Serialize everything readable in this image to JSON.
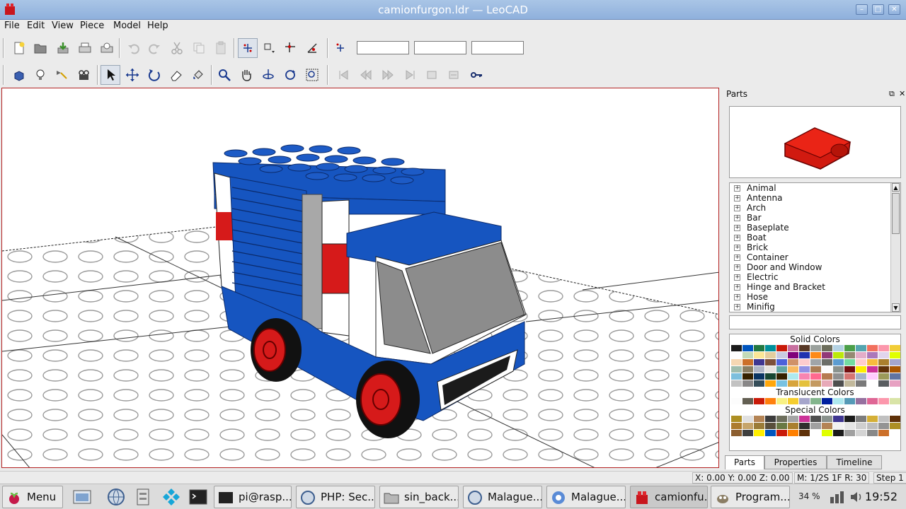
{
  "window": {
    "title": "camionfurgon.ldr — LeoCAD",
    "icon": "leocad-brick-icon",
    "buttons": [
      "minimize-icon",
      "maximize-icon",
      "close-icon"
    ]
  },
  "menu": [
    "File",
    "Edit",
    "View",
    "Piece",
    "Model",
    "Help"
  ],
  "toolbar1": {
    "icons": [
      "new-file-icon",
      "open-folder-icon",
      "save-icon",
      "print-icon",
      "print-preview-icon",
      "undo-icon",
      "redo-icon",
      "cut-icon",
      "copy-icon",
      "paste-icon",
      "snap-move-icon",
      "snap-xy-icon",
      "snap-grid-icon",
      "snap-angle-icon",
      "transform-icon"
    ],
    "coordinate_fields": [
      "",
      "",
      ""
    ]
  },
  "toolbar2": {
    "icons": [
      "insert-brick-icon",
      "light-icon",
      "spotlight-icon",
      "camera-icon",
      "select-arrow-icon",
      "move-icon",
      "rotate-icon",
      "eraser-icon",
      "paint-icon",
      "zoom-icon",
      "pan-hand-icon",
      "rotate-view-icon",
      "roll-icon",
      "zoom-region-icon",
      "first-step-icon",
      "previous-step-icon",
      "next-step-icon",
      "last-step-icon",
      "insert-step-icon",
      "remove-step-icon",
      "key-icon"
    ]
  },
  "parts_panel": {
    "title": "Parts",
    "categories": [
      "Animal",
      "Antenna",
      "Arch",
      "Bar",
      "Baseplate",
      "Boat",
      "Brick",
      "Container",
      "Door and Window",
      "Electric",
      "Hinge and Bracket",
      "Hose",
      "Minifig"
    ],
    "search_value": "",
    "color_groups": [
      {
        "name": "Solid Colors",
        "colors": [
          "#1b1b1b",
          "#0055bf",
          "#237841",
          "#008f9b",
          "#c91a09",
          "#c870a0",
          "#583927",
          "#9ba19d",
          "#6d6e5c",
          "#b4d2e3",
          "#4b9f4a",
          "#55a5af",
          "#f2705e",
          "#fc97ac",
          "#f2cd37",
          "#fefefe",
          "#c2dab8",
          "#fbe696",
          "#e4cd9e",
          "#c9cae2",
          "#81007b",
          "#2032b0",
          "#fe8a18",
          "#923978",
          "#bbe90b",
          "#958a73",
          "#e4adc8",
          "#ac78ba",
          "#e1d5ed",
          "#e0ff00",
          "#f6d7b3",
          "#cc702a",
          "#3f3691",
          "#7c503a",
          "#4c61db",
          "#d09168",
          "#feccce",
          "#a0a5a9",
          "#6c6e68",
          "#5c9dd1",
          "#73dca1",
          "#fecccf",
          "#f8bb3d",
          "#aa7f2e",
          "#a5a5cb",
          "#a0bcac",
          "#897d62",
          "#afb5c7",
          "#e6e3e0",
          "#62a6a4",
          "#f9ba61",
          "#9391e4",
          "#aa7d55",
          "#fcfcfc",
          "#8a928d",
          "#720e0f",
          "#ffee00",
          "#cc3399",
          "#5f3109",
          "#a95500",
          "#7dbfdd",
          "#352100",
          "#0a3463",
          "#184632",
          "#352100",
          "#aee9ef",
          "#f785b1",
          "#ff698f",
          "#b67b50",
          "#909090",
          "#d67572",
          "#a5b2c7",
          "#ffccff",
          "#9b9a5a",
          "#6074a1",
          "#c2c2c2",
          "#898788",
          "#354e5a",
          "#ffa70b",
          "#79c2e1",
          "#d7a43c",
          "#e4c13c",
          "#c49a62",
          "#e7a9b8",
          "#4e4e4e",
          "#c2b99c",
          "#7a7a7a",
          "#ffffff",
          "#595d60",
          "#e7a1c2"
        ]
      },
      {
        "name": "Translucent Colors",
        "colors": [
          "#fcfcfc",
          "#635f52",
          "#c91a09",
          "#ff800d",
          "#f8f184",
          "#f5cd2f",
          "#a5a5cb",
          "#84b68d",
          "#0020a0",
          "#aee9ef",
          "#559ab7",
          "#96709f",
          "#df6695",
          "#fc97ac",
          "#d9e4a7"
        ]
      },
      {
        "name": "Special Colors",
        "colors": [
          "#ad8f23",
          "#e0e0e0",
          "#b48455",
          "#3c3c3c",
          "#6d6e5c",
          "#a5a5a5",
          "#cc3399",
          "#4f4f4f",
          "#8a928d",
          "#3f3691",
          "#1b1b1b",
          "#7d7d7d",
          "#d4af37",
          "#c0c0c0",
          "#5f3109",
          "#ad7c2e",
          "#c6a56b",
          "#9b7c38",
          "#594f3c",
          "#6a7944",
          "#aa7f2e",
          "#2e2e2e",
          "#a0a0a0",
          "#b48455",
          "#f2f2f2",
          "#e6e6e6",
          "#cfcfcf",
          "#bdbdbd",
          "#949494",
          "#ad8f23",
          "#8c5e2f",
          "#3f3f3f",
          "#ffee00",
          "#0055bf",
          "#c91a09",
          "#ff7f00",
          "#5f3109",
          "#ffffff",
          "#e0ff00",
          "#1b1b1b",
          "#a0a0a0",
          "#d4d4d4",
          "#888888",
          "#cc702a",
          "#ffffff"
        ]
      }
    ],
    "tabs": [
      "Parts",
      "Properties",
      "Timeline"
    ]
  },
  "statusbar": {
    "coords": "X: 0.00 Y: 0.00 Z: 0.00",
    "grid": "M: 1/2S 1F R: 30",
    "step": "Step 1"
  },
  "taskbar": {
    "menu_label": "Menu",
    "launchers": [
      "file-manager-icon",
      "browser-globe-icon",
      "archive-icon",
      "kodi-icon",
      "terminal-icon"
    ],
    "items": [
      {
        "label": "pi@rasp...",
        "icon": "terminal-icon"
      },
      {
        "label": "PHP: Sec...",
        "icon": "browser-globe-icon"
      },
      {
        "label": "sin_back...",
        "icon": "folder-icon"
      },
      {
        "label": "Malague...",
        "icon": "browser-globe-icon"
      },
      {
        "label": "Malague...",
        "icon": "chromium-icon"
      },
      {
        "label": "camionfu...",
        "icon": "leocad-brick-icon"
      },
      {
        "label": "Program...",
        "icon": "gimp-icon"
      }
    ],
    "cpu": "34 %",
    "clock": "19:52"
  }
}
